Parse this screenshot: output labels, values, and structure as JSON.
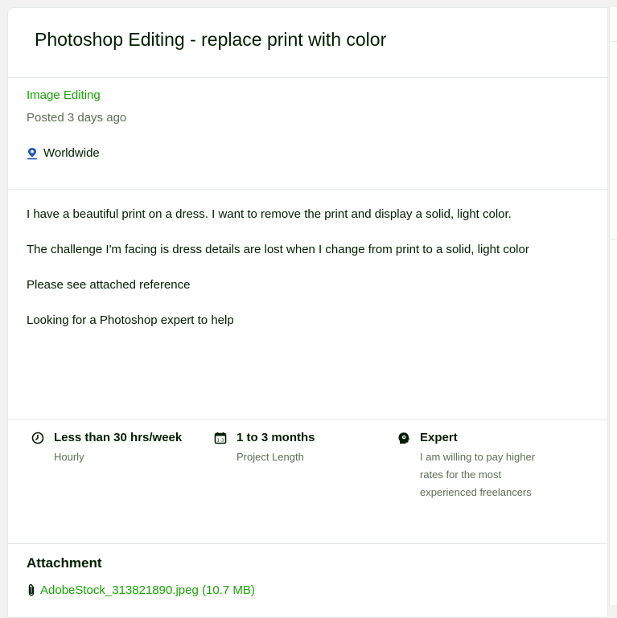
{
  "job": {
    "title": "Photoshop Editing - replace print with color",
    "category": "Image Editing",
    "posted": "Posted 3 days ago",
    "location": "Worldwide"
  },
  "description": [
    "I have a beautiful print on a dress. I want to remove the print and display a solid, light color.",
    "The challenge I'm facing is dress details are lost when I change from print to a solid, light color",
    "Please see attached reference",
    "Looking for a Photoshop expert to help"
  ],
  "features": [
    {
      "icon": "clock-icon",
      "main": "Less than 30 hrs/week",
      "sub": "Hourly"
    },
    {
      "icon": "calendar-icon",
      "main": "1 to 3 months",
      "sub": "Project Length"
    },
    {
      "icon": "expert-head-icon",
      "main": "Expert",
      "sub_lines": [
        "I am willing to pay higher",
        "rates for the most",
        "experienced freelancers"
      ]
    }
  ],
  "attachment": {
    "heading": "Attachment",
    "file": "AdobeStock_313821890.jpeg (10.7 MB)"
  },
  "colors": {
    "accent": "#14a800",
    "text": "#001e00",
    "muted": "#5e6d55",
    "border": "#e4ebe4",
    "location_icon": "#1f57c3"
  }
}
